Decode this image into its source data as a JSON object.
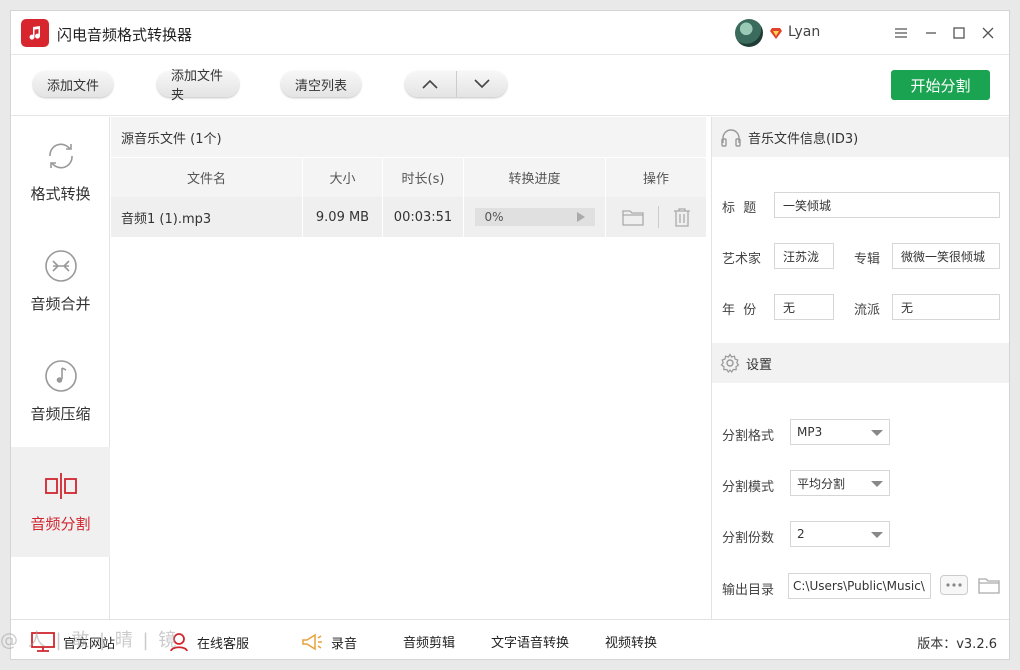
{
  "app": {
    "title": "闪电音频格式转换器",
    "username": "Lyan"
  },
  "toolbar": {
    "add_file": "添加文件",
    "add_folder": "添加文件夹",
    "clear_list": "清空列表",
    "start": "开始分割"
  },
  "sidebar": {
    "items": [
      {
        "label": "格式转换",
        "icon": "refresh-icon"
      },
      {
        "label": "音频合并",
        "icon": "merge-icon"
      },
      {
        "label": "音频压缩",
        "icon": "music-note-icon"
      },
      {
        "label": "音频分割",
        "icon": "split-icon",
        "active": true
      }
    ]
  },
  "filelist": {
    "header": "源音乐文件 (1个)",
    "columns": [
      "文件名",
      "大小",
      "时长(s)",
      "转换进度",
      "操作"
    ],
    "rows": [
      {
        "name": "音频1 (1).mp3",
        "size": "9.09 MB",
        "duration": "00:03:51",
        "progress": "0%"
      }
    ]
  },
  "id3": {
    "header": "音乐文件信息(ID3)",
    "title_label": "标  题",
    "title_value": "一笑倾城",
    "artist_label": "艺术家",
    "artist_value": "汪苏泷",
    "album_label": "专辑",
    "album_value": "微微一笑很倾城",
    "year_label": "年  份",
    "year_value": "无",
    "genre_label": "流派",
    "genre_value": "无"
  },
  "settings": {
    "header": "设置",
    "format_label": "分割格式",
    "format_value": "MP3",
    "mode_label": "分割模式",
    "mode_value": "平均分割",
    "parts_label": "分割份数",
    "parts_value": "2",
    "output_label": "输出目录",
    "output_value": "C:\\Users\\Public\\Music\\"
  },
  "footer": {
    "website": "官方网站",
    "support": "在线客服",
    "record": "录音",
    "audio_edit": "音频剪辑",
    "tts": "文字语音转换",
    "video": "视频转换",
    "version": "版本：v3.2.6"
  },
  "watermark": "@ 人 | 敢 | 晴 | 镜",
  "colors": {
    "accent_red": "#d0262e",
    "start_green": "#1aa452"
  }
}
